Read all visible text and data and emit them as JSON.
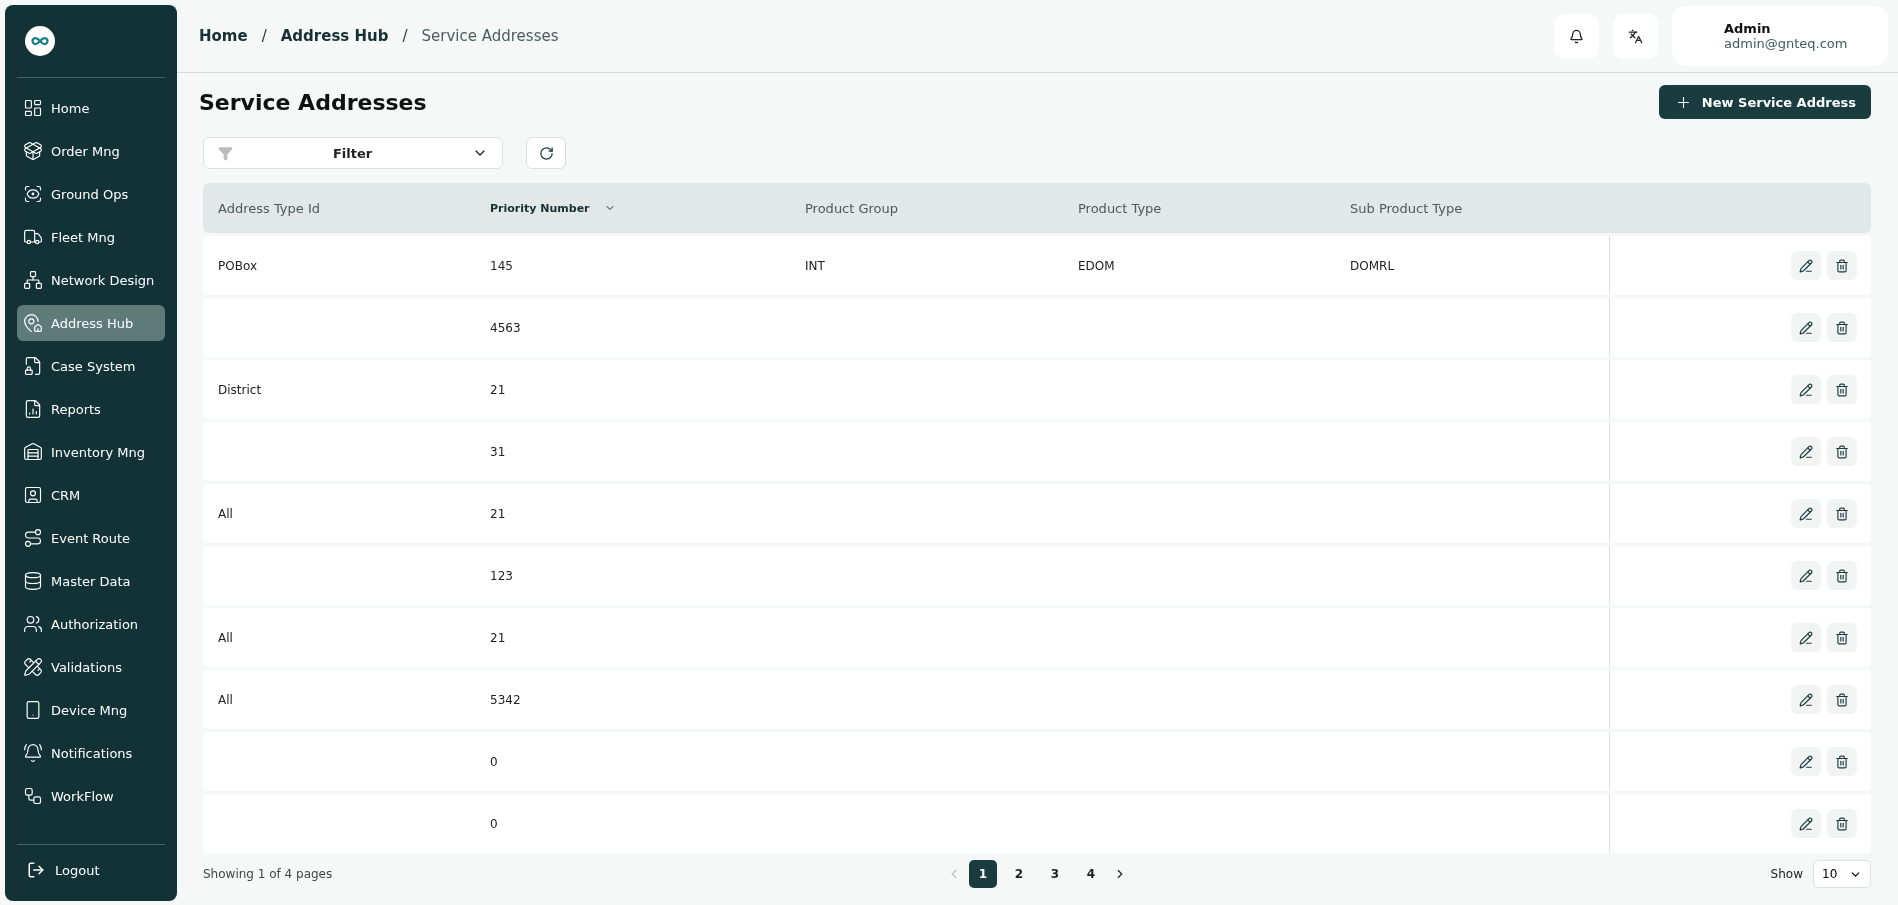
{
  "sidebar": {
    "items": [
      {
        "label": "Home",
        "selected": false
      },
      {
        "label": "Order Mng",
        "selected": false
      },
      {
        "label": "Ground Ops",
        "selected": false
      },
      {
        "label": "Fleet Mng",
        "selected": false
      },
      {
        "label": "Network Design",
        "selected": false
      },
      {
        "label": "Address Hub",
        "selected": true
      },
      {
        "label": "Case System",
        "selected": false
      },
      {
        "label": "Reports",
        "selected": false
      },
      {
        "label": "Inventory Mng",
        "selected": false
      },
      {
        "label": "CRM",
        "selected": false
      },
      {
        "label": "Event Route",
        "selected": false
      },
      {
        "label": "Master Data",
        "selected": false
      },
      {
        "label": "Authorization",
        "selected": false
      },
      {
        "label": "Validations",
        "selected": false
      },
      {
        "label": "Device Mng",
        "selected": false
      },
      {
        "label": "Notifications",
        "selected": false
      },
      {
        "label": "WorkFlow",
        "selected": false
      }
    ],
    "logout": "Logout"
  },
  "breadcrumb": [
    {
      "label": "Home",
      "current": false
    },
    {
      "label": "Address Hub",
      "current": false
    },
    {
      "label": "Service Addresses",
      "current": true
    }
  ],
  "breadcrumb_separators": [
    "/",
    "/"
  ],
  "user": {
    "name": "Admin",
    "email": "admin@gnteq.com"
  },
  "page_title": "Service Addresses",
  "new_button": "New Service Address",
  "filter": {
    "label": "Filter"
  },
  "table": {
    "columns": [
      {
        "label": "Address Type Id",
        "sorted": false
      },
      {
        "label": "Priority Number",
        "sorted": true
      },
      {
        "label": "Product Group",
        "sorted": false
      },
      {
        "label": "Product Type",
        "sorted": false
      },
      {
        "label": "Sub Product Type",
        "sorted": false
      }
    ],
    "rows": [
      [
        "POBox",
        "145",
        "INT",
        "EDOM",
        "DOMRL"
      ],
      [
        "",
        "4563",
        "",
        "",
        ""
      ],
      [
        "District",
        "21",
        "",
        "",
        ""
      ],
      [
        "",
        "31",
        "",
        "",
        ""
      ],
      [
        "All",
        "21",
        "",
        "",
        ""
      ],
      [
        "",
        "123",
        "",
        "",
        ""
      ],
      [
        "All",
        "21",
        "",
        "",
        ""
      ],
      [
        "All",
        "5342",
        "",
        "",
        ""
      ],
      [
        "",
        "0",
        "",
        "",
        ""
      ],
      [
        "",
        "0",
        "",
        "",
        ""
      ]
    ]
  },
  "footer": {
    "summary": "Showing 1 of 4 pages",
    "pages": [
      {
        "label": "1",
        "selected": true
      },
      {
        "label": "2",
        "selected": false
      },
      {
        "label": "3",
        "selected": false
      },
      {
        "label": "4",
        "selected": false
      }
    ],
    "prev_disabled": true,
    "next_disabled": false,
    "show_label": "Show",
    "page_size": "10"
  }
}
